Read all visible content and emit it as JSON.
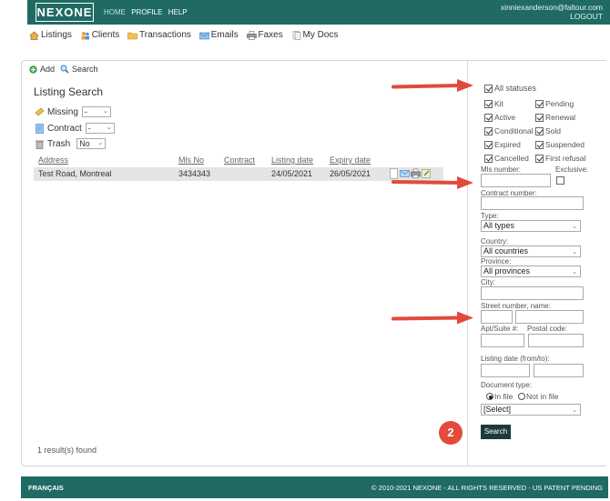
{
  "topbar": {
    "logo": "NEXONE",
    "nav": [
      "HOME",
      "PROFILE",
      "HELP"
    ],
    "email": "xinniexanderson@faltour.com",
    "logout": "LOGOUT"
  },
  "subnav": [
    "Listings",
    "Clients",
    "Transactions",
    "Emails",
    "Faxes",
    "My Docs"
  ],
  "toolbar": {
    "add": "Add",
    "search": "Search"
  },
  "title": "Listing Search",
  "filters": {
    "missing": {
      "label": "Missing",
      "value": "-"
    },
    "contract": {
      "label": "Contract",
      "value": "-"
    },
    "trash": {
      "label": "Trash",
      "value": "No"
    }
  },
  "table": {
    "headers": [
      "Address",
      "Mls No",
      "Contract",
      "Listing date",
      "Expiry date"
    ],
    "rows": [
      {
        "address": "Test Road, Montreal",
        "mls": "3434343",
        "contract": "",
        "listing_date": "24/05/2021",
        "expiry_date": "26/05/2021"
      }
    ]
  },
  "results": "1 result(s) found",
  "panel": {
    "all_statuses": "All statuses",
    "statuses": [
      "Kit",
      "Pending",
      "Active",
      "Renewal",
      "Conditional",
      "Sold",
      "Expired",
      "Suspended",
      "Cancelled",
      "First refusal"
    ],
    "mls_label": "Mls number:",
    "exclusive_label": "Exclusive:",
    "contract_label": "Contract number:",
    "type_label": "Type:",
    "type_value": "All types",
    "country_label": "Country:",
    "country_value": "All countries",
    "province_label": "Province:",
    "province_value": "All provinces",
    "city_label": "City:",
    "street_label": "Street number, name:",
    "apt_label": "Apt/Suite #:",
    "postal_label": "Postal code:",
    "listing_date_label": "Listing date (from/to):",
    "doctype_label": "Document type:",
    "in_file": "In file",
    "not_in_file": "Not in file",
    "doctype_value": "[Select]",
    "search_button": "Search"
  },
  "badge": "2",
  "footer": {
    "language": "FRANÇAIS",
    "copyright": "© 2010-2021 NEXONE - ALL RIGHTS RESERVED - US PATENT PENDING"
  },
  "colors": {
    "brand": "#1f6b63",
    "arrow": "#e24a3a",
    "button": "#1d3a3a"
  }
}
